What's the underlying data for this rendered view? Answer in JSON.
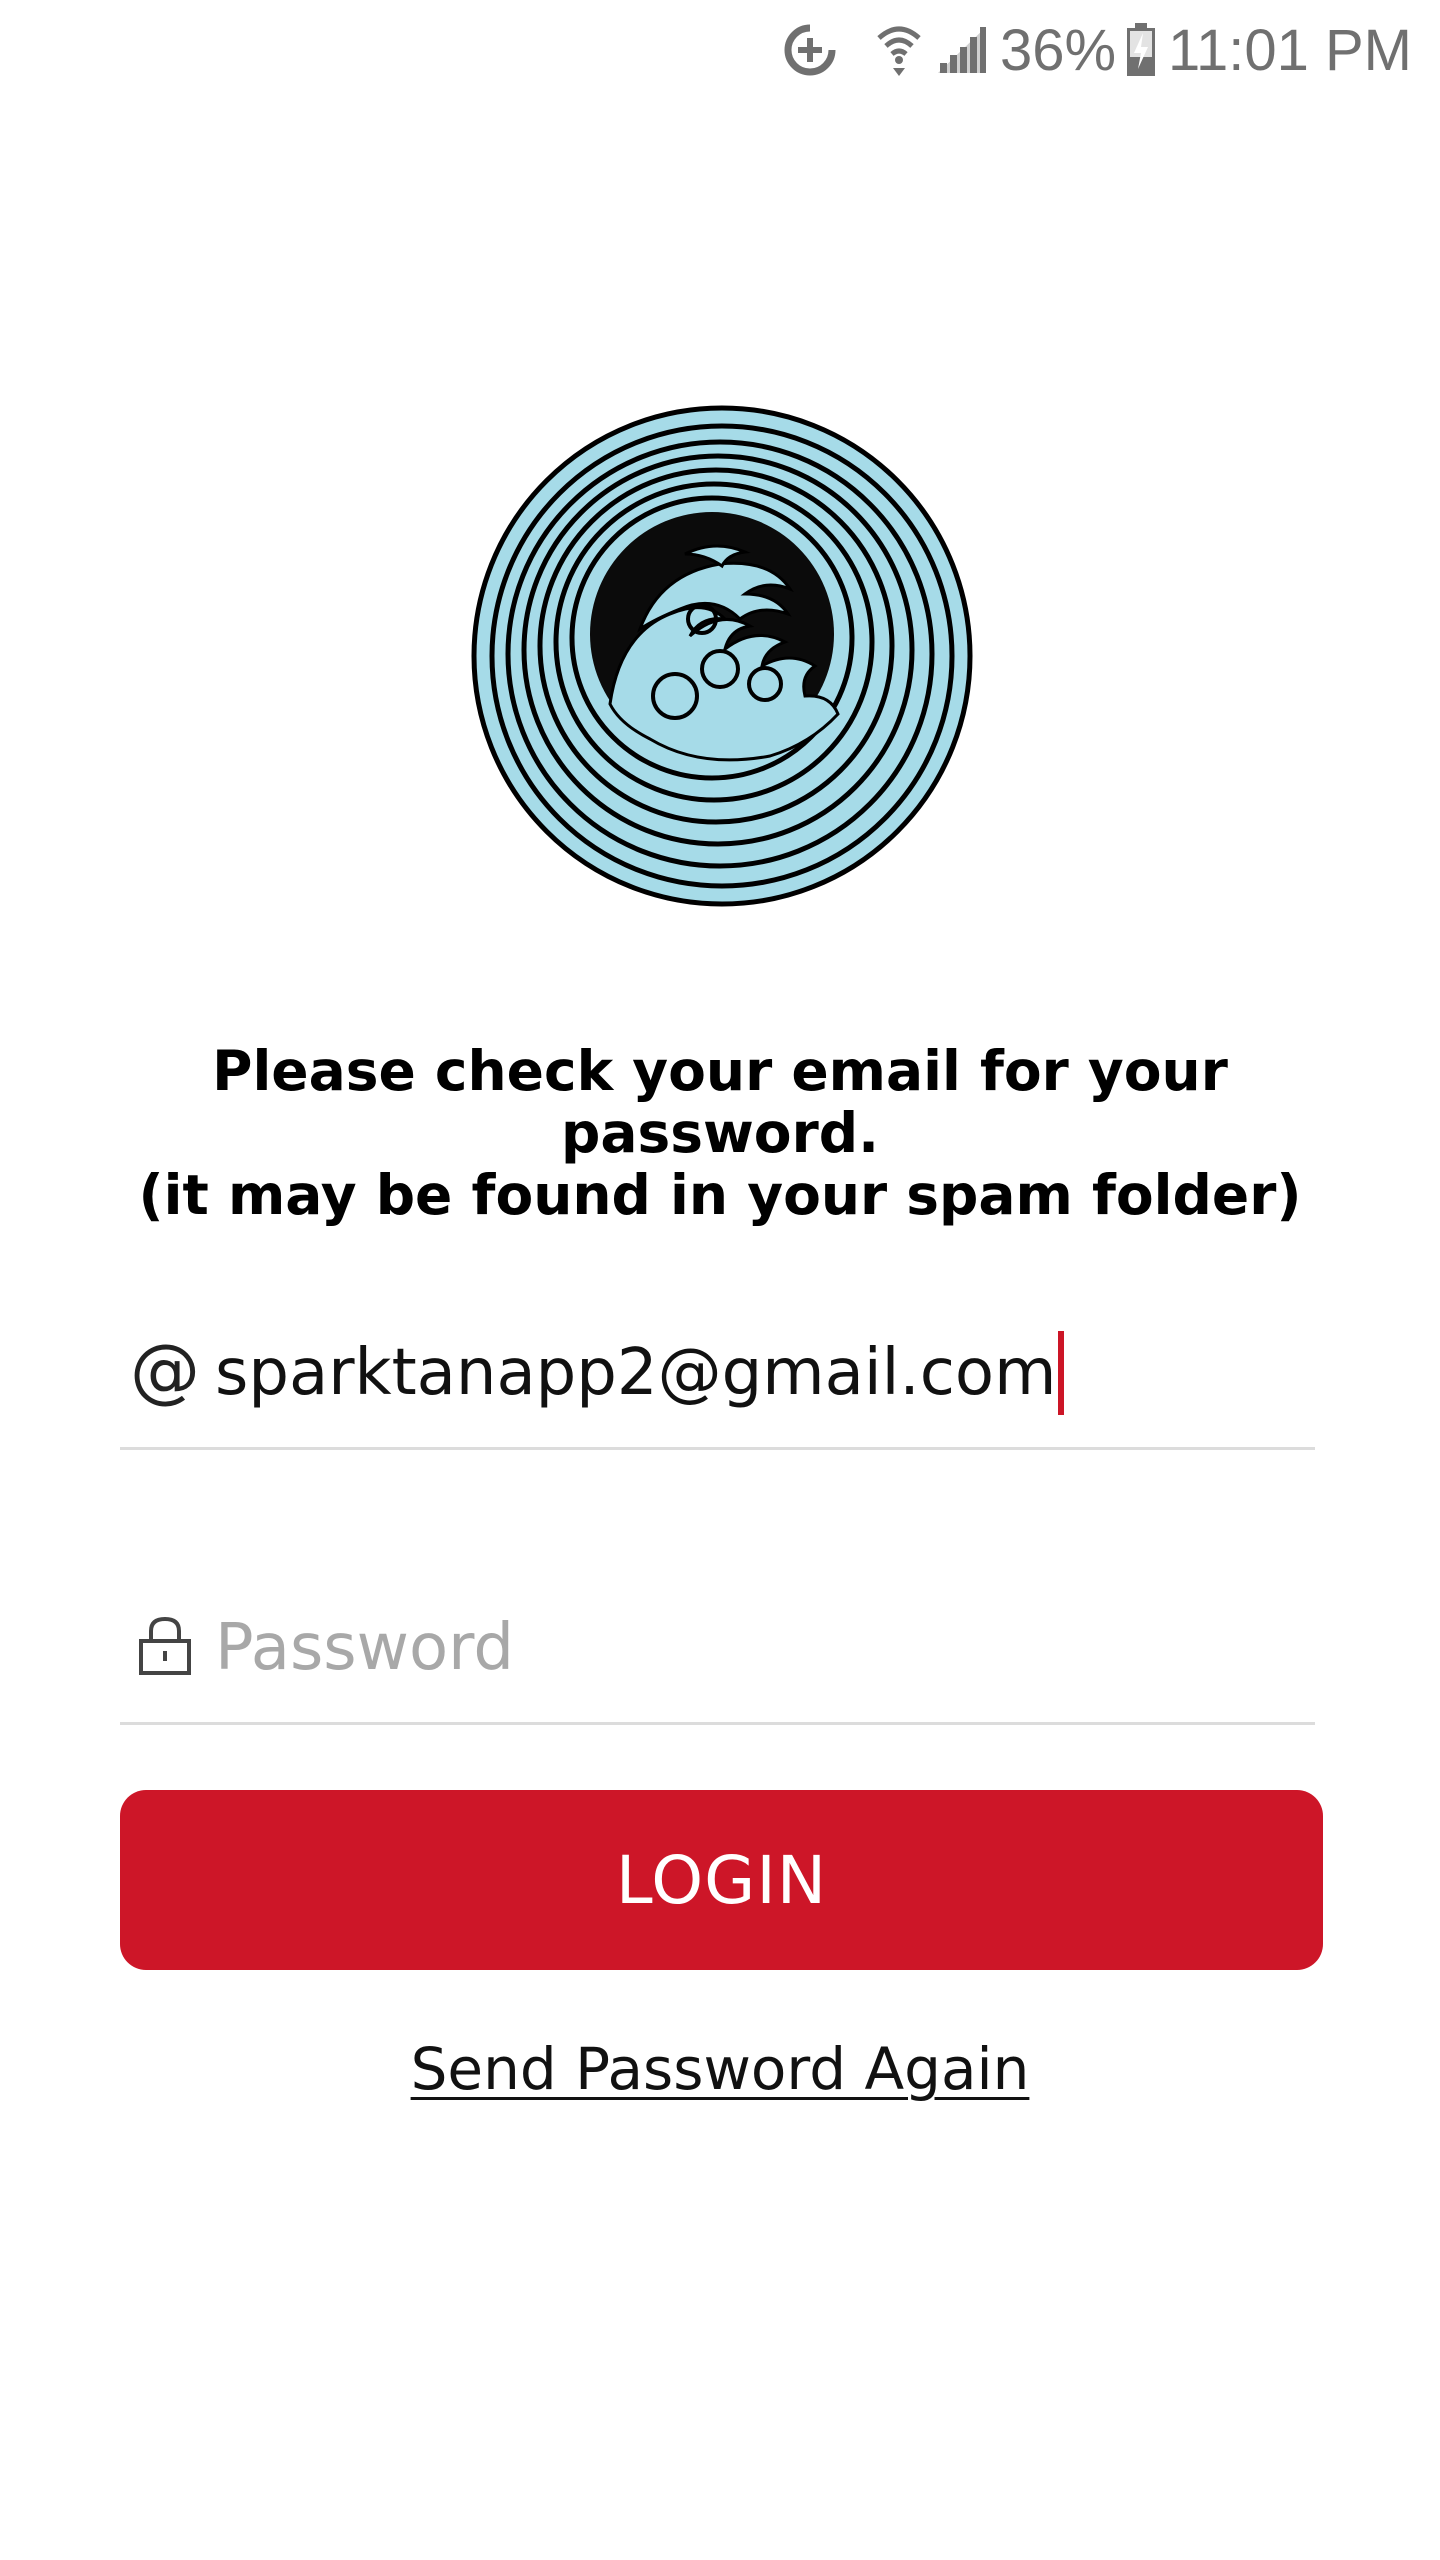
{
  "status_bar": {
    "icons": [
      "data-saver-icon",
      "wifi-icon",
      "signal-icon",
      "battery-charging-icon"
    ],
    "battery_percent": "36%",
    "time": "11:01 PM"
  },
  "logo": {
    "icon": "wave-logo-icon",
    "colors": {
      "ring": "#a6dbe8",
      "outline": "#000000",
      "center": "#0b0b0b"
    }
  },
  "message": {
    "line1": "Please check your email for your",
    "line2": "password.",
    "line3": "(it may be found in your spam folder)"
  },
  "email_field": {
    "icon": "at-icon",
    "value": "sparktanapp2@gmail.com"
  },
  "password_field": {
    "icon": "lock-icon",
    "placeholder": "Password",
    "value": ""
  },
  "login_button": {
    "label": "LOGIN",
    "color": "#cd1628"
  },
  "send_again_link": {
    "label": "Send Password Again"
  }
}
